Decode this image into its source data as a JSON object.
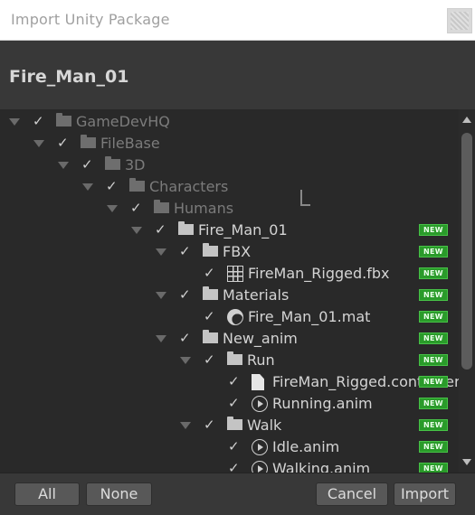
{
  "window": {
    "title": "Import Unity Package"
  },
  "package": {
    "name": "Fire_Man_01"
  },
  "tree": [
    {
      "label": "GameDevHQ",
      "depth": 0,
      "foldout": true,
      "checked": true,
      "kind": "folder",
      "dim": true,
      "new": false
    },
    {
      "label": "FileBase",
      "depth": 1,
      "foldout": true,
      "checked": true,
      "kind": "folder",
      "dim": true,
      "new": false
    },
    {
      "label": "3D",
      "depth": 2,
      "foldout": true,
      "checked": true,
      "kind": "folder",
      "dim": true,
      "new": false
    },
    {
      "label": "Characters",
      "depth": 3,
      "foldout": true,
      "checked": true,
      "kind": "folder",
      "dim": true,
      "new": false
    },
    {
      "label": "Humans",
      "depth": 4,
      "foldout": true,
      "checked": true,
      "kind": "folder",
      "dim": true,
      "new": false
    },
    {
      "label": "Fire_Man_01",
      "depth": 5,
      "foldout": true,
      "checked": true,
      "kind": "folder",
      "dim": false,
      "new": true
    },
    {
      "label": "FBX",
      "depth": 6,
      "foldout": true,
      "checked": true,
      "kind": "folder",
      "dim": false,
      "new": true
    },
    {
      "label": "FireMan_Rigged.fbx",
      "depth": 7,
      "foldout": false,
      "checked": true,
      "kind": "mesh",
      "dim": false,
      "new": true
    },
    {
      "label": "Materials",
      "depth": 6,
      "foldout": true,
      "checked": true,
      "kind": "folder",
      "dim": false,
      "new": true
    },
    {
      "label": "Fire_Man_01.mat",
      "depth": 7,
      "foldout": false,
      "checked": true,
      "kind": "material",
      "dim": false,
      "new": true
    },
    {
      "label": "New_anim",
      "depth": 6,
      "foldout": true,
      "checked": true,
      "kind": "folder",
      "dim": false,
      "new": true
    },
    {
      "label": "Run",
      "depth": 7,
      "foldout": true,
      "checked": true,
      "kind": "folder",
      "dim": false,
      "new": true
    },
    {
      "label": "FireMan_Rigged.controller",
      "depth": 8,
      "foldout": false,
      "checked": true,
      "kind": "document",
      "dim": false,
      "new": true
    },
    {
      "label": "Running.anim",
      "depth": 8,
      "foldout": false,
      "checked": true,
      "kind": "animation",
      "dim": false,
      "new": true
    },
    {
      "label": "Walk",
      "depth": 7,
      "foldout": true,
      "checked": true,
      "kind": "folder",
      "dim": false,
      "new": true
    },
    {
      "label": "Idle.anim",
      "depth": 8,
      "foldout": false,
      "checked": true,
      "kind": "animation",
      "dim": false,
      "new": true
    },
    {
      "label": "Walking.anim",
      "depth": 8,
      "foldout": false,
      "checked": true,
      "kind": "animation",
      "dim": false,
      "new": true
    }
  ],
  "badge_label": "NEW",
  "check_glyph": "✓",
  "buttons": {
    "all": "All",
    "none": "None",
    "cancel": "Cancel",
    "import": "Import"
  },
  "colors": {
    "badge": "#2a9b2a",
    "tree_bg": "#292929",
    "panel_bg": "#383838",
    "title_bar": "#ffffff"
  }
}
